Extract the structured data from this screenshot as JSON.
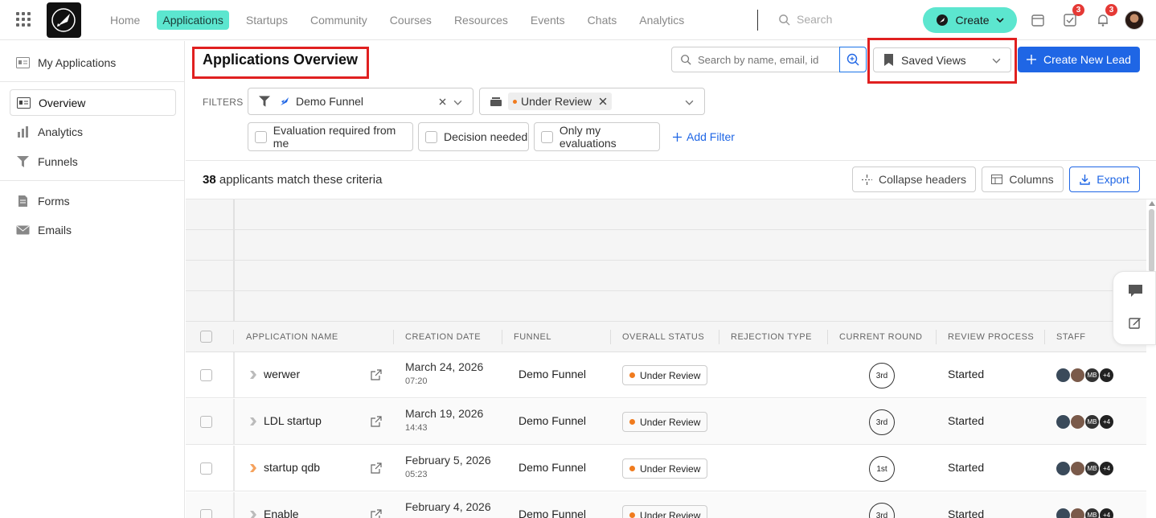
{
  "topnav": {
    "items": [
      {
        "label": "Home",
        "active": false
      },
      {
        "label": "Applications",
        "active": true
      },
      {
        "label": "Startups",
        "active": false
      },
      {
        "label": "Community",
        "active": false
      },
      {
        "label": "Courses",
        "active": false
      },
      {
        "label": "Resources",
        "active": false
      },
      {
        "label": "Events",
        "active": false
      },
      {
        "label": "Chats",
        "active": false
      },
      {
        "label": "Analytics",
        "active": false
      }
    ],
    "search_placeholder": "Search",
    "create_label": "Create",
    "tasks_badge": "3",
    "notifications_badge": "3"
  },
  "sidebar": {
    "items": [
      {
        "label": "My Applications",
        "icon": "id-card-icon"
      },
      {
        "label": "Overview",
        "icon": "id-card-icon",
        "active": true
      },
      {
        "label": "Analytics",
        "icon": "bar-chart-icon"
      },
      {
        "label": "Funnels",
        "icon": "funnel-icon"
      },
      {
        "label": "Forms",
        "icon": "document-icon"
      },
      {
        "label": "Emails",
        "icon": "mail-icon"
      }
    ]
  },
  "header": {
    "title": "Applications Overview",
    "search_placeholder": "Search by name, email, id",
    "saved_views_label": "Saved Views",
    "create_lead_label": "Create New Lead"
  },
  "filters": {
    "label": "FILTERS",
    "funnel_value": "Demo Funnel",
    "status_chip": "Under Review",
    "checkboxes": [
      "Evaluation required from me",
      "Decision needed",
      "Only my evaluations"
    ],
    "add_filter_label": "Add Filter"
  },
  "results": {
    "count": "38",
    "count_suffix": "applicants match these criteria",
    "collapse_label": "Collapse headers",
    "columns_label": "Columns",
    "export_label": "Export"
  },
  "table": {
    "columns": [
      "APPLICATION NAME",
      "CREATION DATE",
      "FUNNEL",
      "OVERALL STATUS",
      "REJECTION TYPE",
      "CURRENT ROUND",
      "REVIEW PROCESS",
      "STAFF"
    ],
    "rows": [
      {
        "name": "werwer",
        "date": "March 24, 2026",
        "time": "07:20",
        "funnel": "Demo Funnel",
        "status": "Under Review",
        "round": "3rd",
        "review": "Started",
        "staff_initials": "MB",
        "staff_more": "+4",
        "arrow_color": "#bbbbbb"
      },
      {
        "name": "LDL startup",
        "date": "March 19, 2026",
        "time": "14:43",
        "funnel": "Demo Funnel",
        "status": "Under Review",
        "round": "3rd",
        "review": "Started",
        "staff_initials": "MB",
        "staff_more": "+4",
        "arrow_color": "#bbbbbb"
      },
      {
        "name": "startup qdb",
        "date": "February 5, 2026",
        "time": "05:23",
        "funnel": "Demo Funnel",
        "status": "Under Review",
        "round": "1st",
        "review": "Started",
        "staff_initials": "MB",
        "staff_more": "+4",
        "arrow_color": "#f5a25d"
      },
      {
        "name": "Enable",
        "date": "February 4, 2026",
        "time": "",
        "funnel": "Demo Funnel",
        "status": "Under Review",
        "round": "3rd",
        "review": "Started",
        "staff_initials": "MB",
        "staff_more": "+4",
        "arrow_color": "#bbbbbb"
      }
    ]
  },
  "colors": {
    "accent": "#5ce6cf",
    "primary": "#1f66e5",
    "status_dot": "#f07b1e",
    "highlight": "#e02020"
  }
}
